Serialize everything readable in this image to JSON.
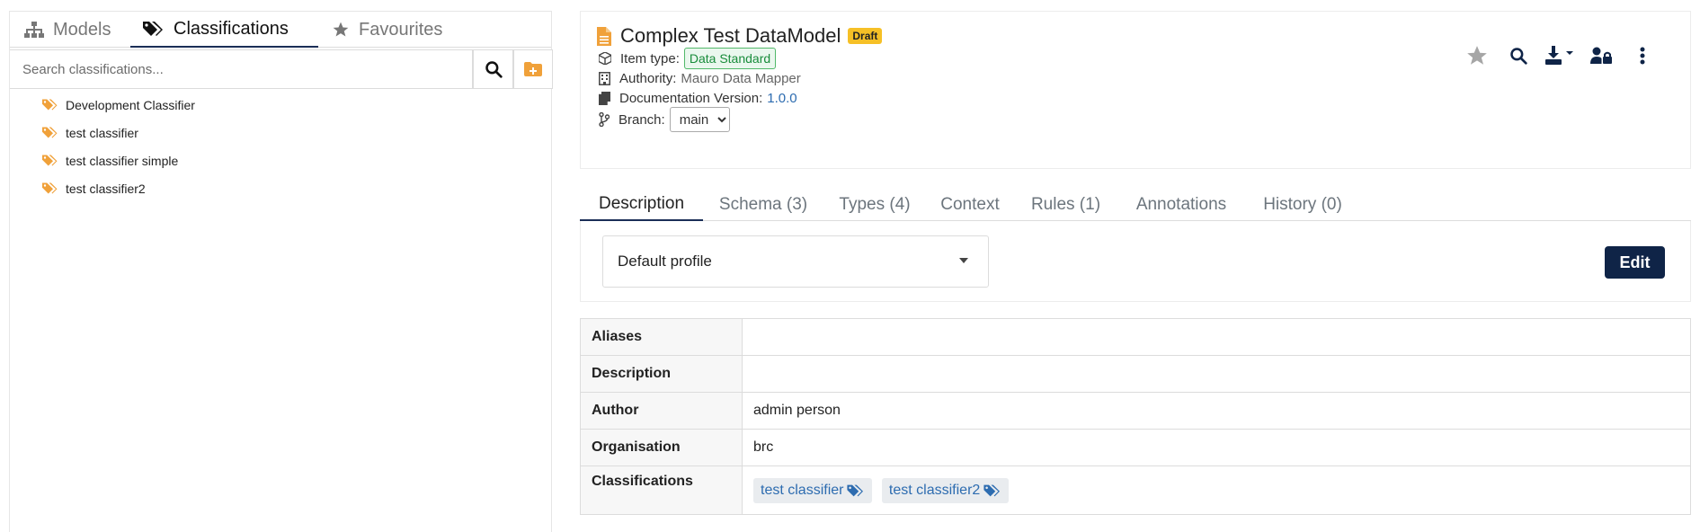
{
  "sidebar": {
    "tabs": [
      {
        "label": "Models",
        "icon": "sitemap-icon"
      },
      {
        "label": "Classifications",
        "icon": "tags-icon"
      },
      {
        "label": "Favourites",
        "icon": "star-icon"
      }
    ],
    "search_placeholder": "Search classifications...",
    "tree": [
      {
        "label": "Development Classifier",
        "icon": "tags-icon"
      },
      {
        "label": "test classifier",
        "icon": "tags-icon"
      },
      {
        "label": "test classifier simple",
        "icon": "tags-icon"
      },
      {
        "label": "test classifier2",
        "icon": "tags-icon"
      }
    ]
  },
  "header": {
    "title": "Complex Test DataModel",
    "status_badge": "Draft",
    "item_type_label": "Item type:",
    "item_type_value": "Data Standard",
    "authority_label": "Authority:",
    "authority_value": "Mauro Data Mapper",
    "doc_version_label": "Documentation Version:",
    "doc_version_value": "1.0.0",
    "branch_label": "Branch:",
    "branch_value": "main"
  },
  "detail_tabs": [
    "Description",
    "Schema (3)",
    "Types (4)",
    "Context",
    "Rules (1)",
    "Annotations",
    "History (0)"
  ],
  "profile": {
    "selected": "Default profile",
    "edit_label": "Edit"
  },
  "properties": [
    {
      "key": "Aliases",
      "value": ""
    },
    {
      "key": "Description",
      "value": ""
    },
    {
      "key": "Author",
      "value": "admin person"
    },
    {
      "key": "Organisation",
      "value": "brc"
    }
  ],
  "classifications": {
    "key": "Classifications",
    "chips": [
      "test classifier",
      "test classifier2"
    ]
  },
  "colors": {
    "accent": "#1b2e57",
    "draft": "#f6c026",
    "tag_icon": "#f0a13a",
    "link": "#2d6cb0",
    "edit_button": "#0f2447"
  }
}
